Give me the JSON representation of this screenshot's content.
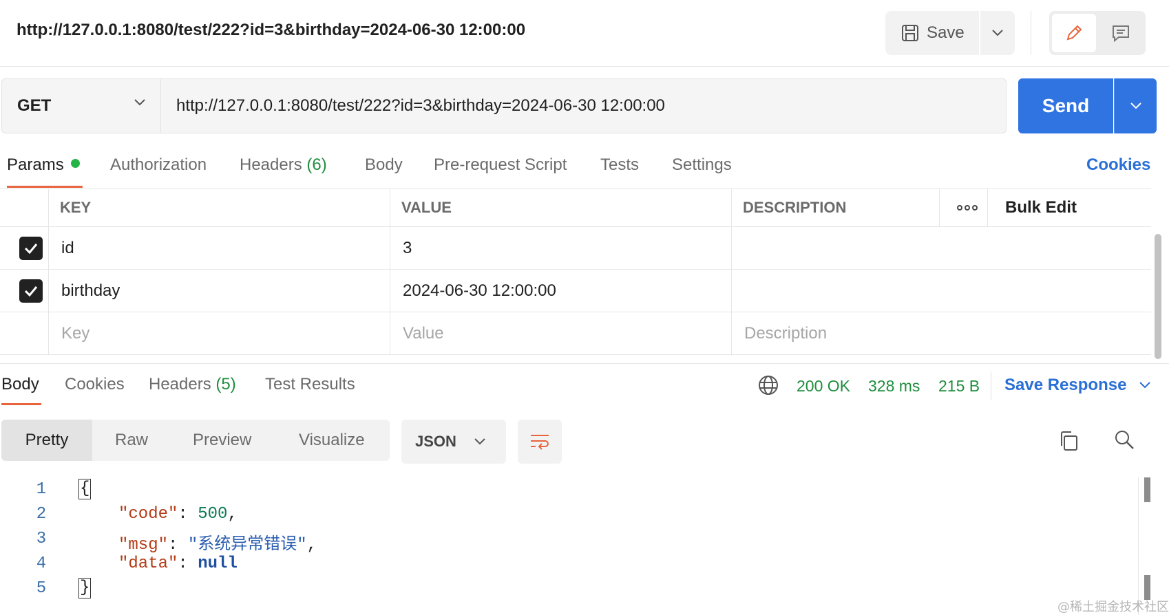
{
  "request": {
    "title": "http://127.0.0.1:8080/test/222?id=3&birthday=2024-06-30 12:00:00",
    "method": "GET",
    "url": "http://127.0.0.1:8080/test/222?id=3&birthday=2024-06-30 12:00:00"
  },
  "toolbar": {
    "save_label": "Save",
    "send_label": "Send"
  },
  "request_tabs": {
    "params": "Params",
    "authorization": "Authorization",
    "headers": "Headers",
    "headers_count": "(6)",
    "body": "Body",
    "prerequest": "Pre-request Script",
    "tests": "Tests",
    "settings": "Settings",
    "cookies": "Cookies"
  },
  "params_table": {
    "headers": {
      "key": "KEY",
      "value": "VALUE",
      "description": "DESCRIPTION",
      "bulk_edit": "Bulk Edit"
    },
    "rows": [
      {
        "key": "id",
        "value": "3",
        "description": ""
      },
      {
        "key": "birthday",
        "value": "2024-06-30 12:00:00",
        "description": ""
      }
    ],
    "placeholders": {
      "key": "Key",
      "value": "Value",
      "description": "Description"
    }
  },
  "response_tabs": {
    "body": "Body",
    "cookies": "Cookies",
    "headers": "Headers",
    "headers_count": "(5)",
    "test_results": "Test Results"
  },
  "response_status": {
    "status": "200 OK",
    "time": "328 ms",
    "size": "215 B",
    "save_response": "Save Response"
  },
  "format_bar": {
    "pretty": "Pretty",
    "raw": "Raw",
    "preview": "Preview",
    "visualize": "Visualize",
    "language": "JSON"
  },
  "code_lines": {
    "numbers": [
      "1",
      "2",
      "3",
      "4",
      "5"
    ],
    "open_brace": "{",
    "close_brace": "}",
    "code_key": "\"code\"",
    "code_value": "500",
    "msg_key": "\"msg\"",
    "msg_value": "\"系统异常错误\"",
    "data_key": "\"data\"",
    "data_value": "null"
  },
  "watermark": "@稀土掘金技术社区",
  "colors": {
    "accent_blue": "#2f74e0",
    "tab_underline": "#e8643c",
    "status_green": "#1f8e3d",
    "params_dot": "#26b446"
  }
}
